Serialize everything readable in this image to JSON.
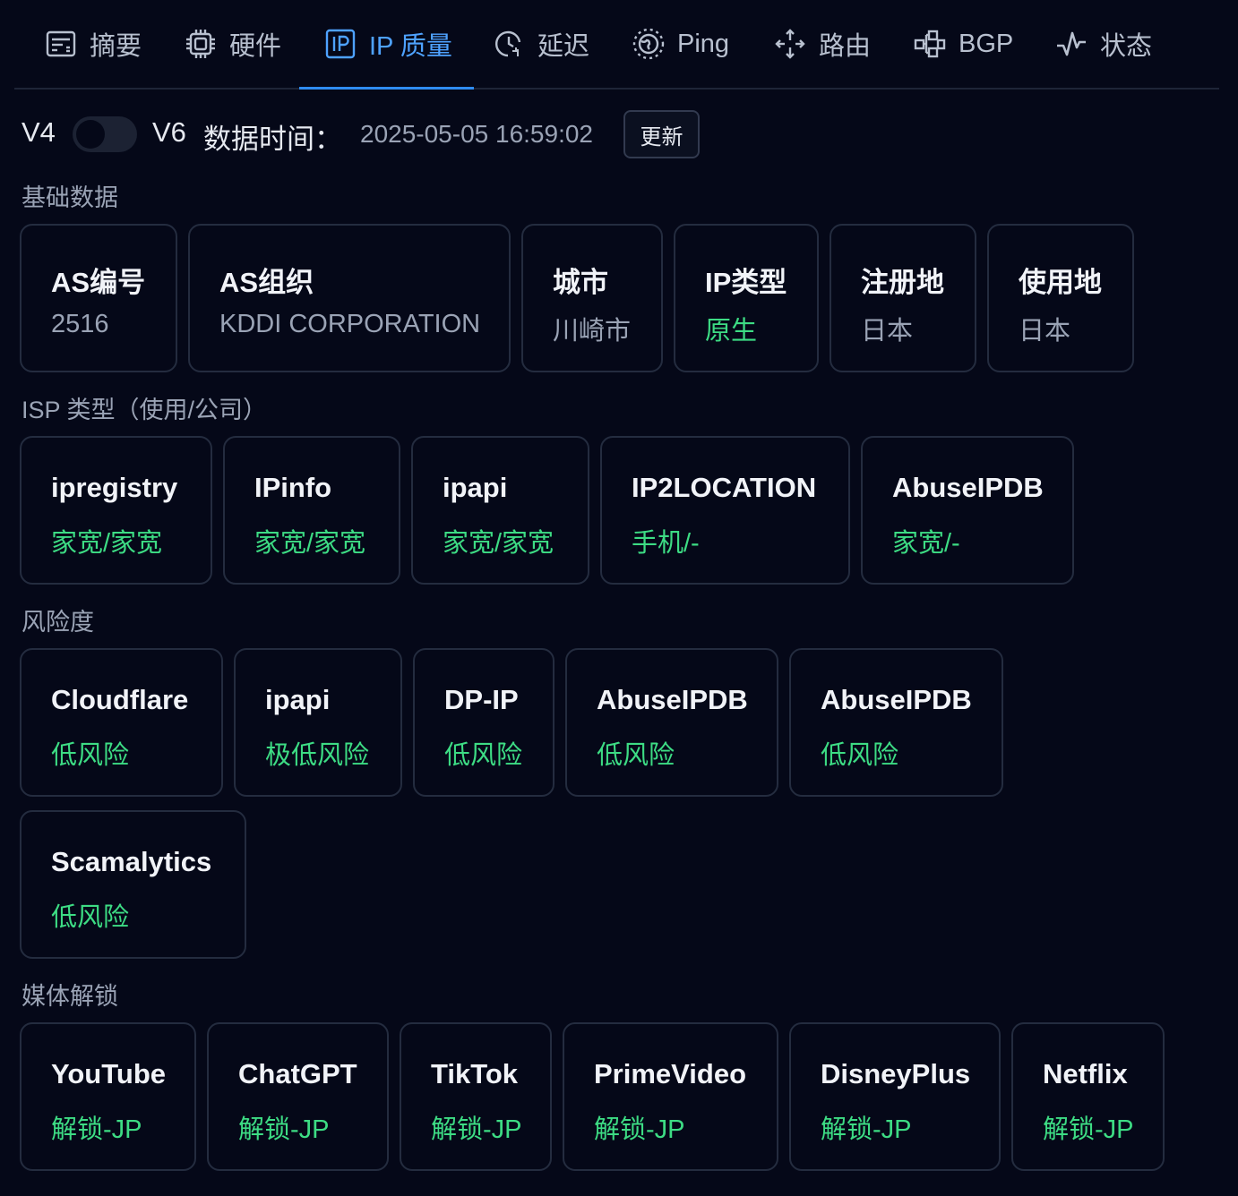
{
  "tabs": [
    {
      "label": "摘要",
      "icon": "summary-icon"
    },
    {
      "label": "硬件",
      "icon": "chip-icon"
    },
    {
      "label": "IP 质量",
      "icon": "ip-icon",
      "active": true
    },
    {
      "label": "延迟",
      "icon": "latency-clock-icon"
    },
    {
      "label": "Ping",
      "icon": "globe-icon"
    },
    {
      "label": "路由",
      "icon": "route-icon"
    },
    {
      "label": "BGP",
      "icon": "bgp-network-icon"
    },
    {
      "label": "状态",
      "icon": "activity-icon"
    }
  ],
  "toolbar": {
    "v4_label": "V4",
    "v6_label": "V6",
    "toggle_state": "off",
    "time_label": "数据时间：",
    "time_value": "2025-05-05 16:59:02",
    "update_label": "更新"
  },
  "sections": {
    "basic": {
      "title": "基础数据",
      "cards": [
        {
          "title": "AS编号",
          "value": "2516",
          "status": "neutral"
        },
        {
          "title": "AS组织",
          "value": "KDDI CORPORATION",
          "status": "neutral"
        },
        {
          "title": "城市",
          "value": "川崎市",
          "status": "neutral"
        },
        {
          "title": "IP类型",
          "value": "原生",
          "status": "good"
        },
        {
          "title": "注册地",
          "value": "日本",
          "status": "neutral"
        },
        {
          "title": "使用地",
          "value": "日本",
          "status": "neutral"
        }
      ]
    },
    "isp": {
      "title": "ISP 类型（使用/公司）",
      "cards": [
        {
          "title": "ipregistry",
          "value": "家宽/家宽",
          "status": "good"
        },
        {
          "title": "IPinfo",
          "value": "家宽/家宽",
          "status": "good"
        },
        {
          "title": "ipapi",
          "value": "家宽/家宽",
          "status": "good"
        },
        {
          "title": "IP2LOCATION",
          "value": "手机/-",
          "status": "good"
        },
        {
          "title": "AbuseIPDB",
          "value": "家宽/-",
          "status": "good"
        }
      ]
    },
    "risk": {
      "title": "风险度",
      "cards": [
        {
          "title": "Cloudflare",
          "value": "低风险",
          "status": "good"
        },
        {
          "title": "ipapi",
          "value": "极低风险",
          "status": "good"
        },
        {
          "title": "DP-IP",
          "value": "低风险",
          "status": "good"
        },
        {
          "title": "AbuseIPDB",
          "value": "低风险",
          "status": "good"
        },
        {
          "title": "AbuseIPDB",
          "value": "低风险",
          "status": "good"
        },
        {
          "title": "Scamalytics",
          "value": "低风险",
          "status": "good"
        }
      ]
    },
    "media": {
      "title": "媒体解锁",
      "cards": [
        {
          "title": "YouTube",
          "value": "解锁-JP",
          "status": "good"
        },
        {
          "title": "ChatGPT",
          "value": "解锁-JP",
          "status": "good"
        },
        {
          "title": "TikTok",
          "value": "解锁-JP",
          "status": "good"
        },
        {
          "title": "PrimeVideo",
          "value": "解锁-JP",
          "status": "good"
        },
        {
          "title": "DisneyPlus",
          "value": "解锁-JP",
          "status": "good"
        },
        {
          "title": "Netflix",
          "value": "解锁-JP",
          "status": "good"
        }
      ]
    }
  },
  "colors": {
    "background": "#050818",
    "accent": "#2f8cf0",
    "good": "#3ddc84",
    "muted": "#9aa3b5",
    "card_border": "#242c3f"
  }
}
